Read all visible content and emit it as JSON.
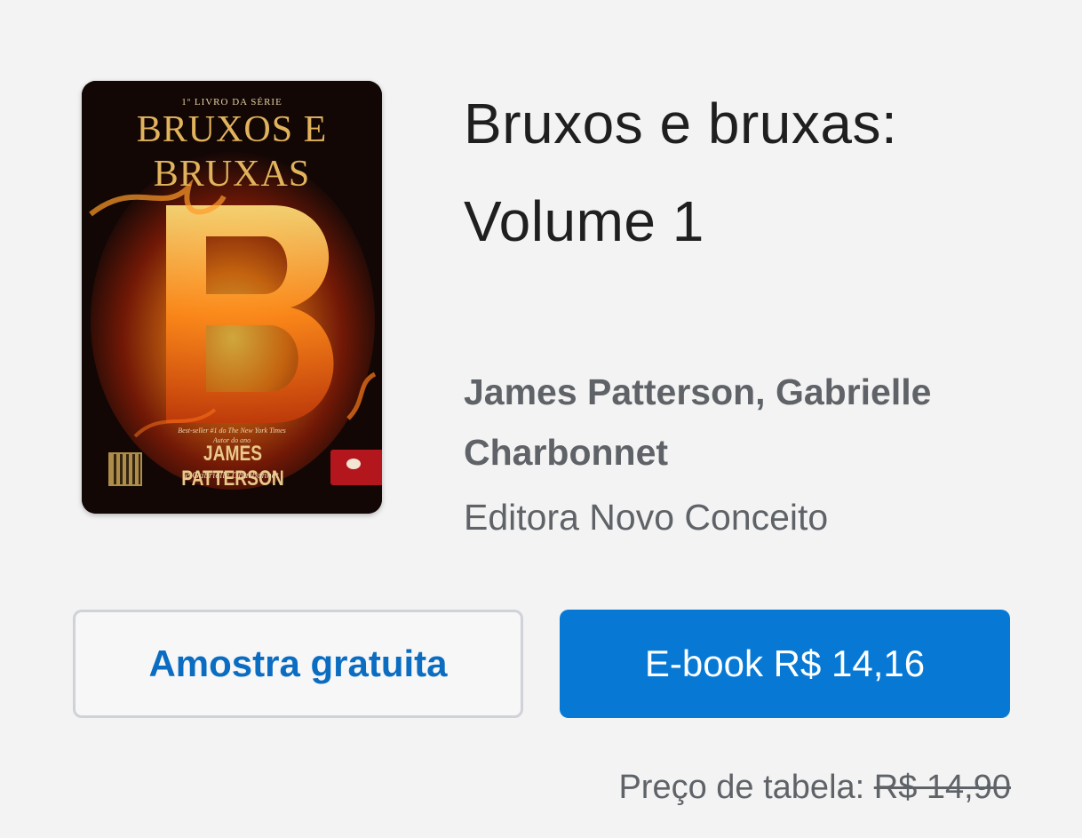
{
  "book": {
    "cover": {
      "series": "1º LIVRO DA SÉRIE",
      "title_line1": "BRUXOS E",
      "title_line2": "BRUXAS",
      "blurb_line1": "Best-seller #1 do The New York Times",
      "blurb_line2": "Autor do ano",
      "author": "JAMES PATTERSON",
      "coauthor": "e Gabrielle Charbonnet"
    },
    "title": "Bruxos e bruxas: Volume 1",
    "authors": "James Patterson, Gabrielle Charbonnet",
    "publisher": "Editora Novo Conceito"
  },
  "actions": {
    "sample_label": "Amostra gratuita",
    "buy_label": "E-book R$ 14,16"
  },
  "pricing": {
    "list_price_label": "Preço de tabela:",
    "list_price_value": "R$ 14,90"
  },
  "colors": {
    "background": "#f3f3f3",
    "accent": "#0779d5",
    "link_text": "#0b6dc2",
    "secondary_text": "#5f6368"
  }
}
